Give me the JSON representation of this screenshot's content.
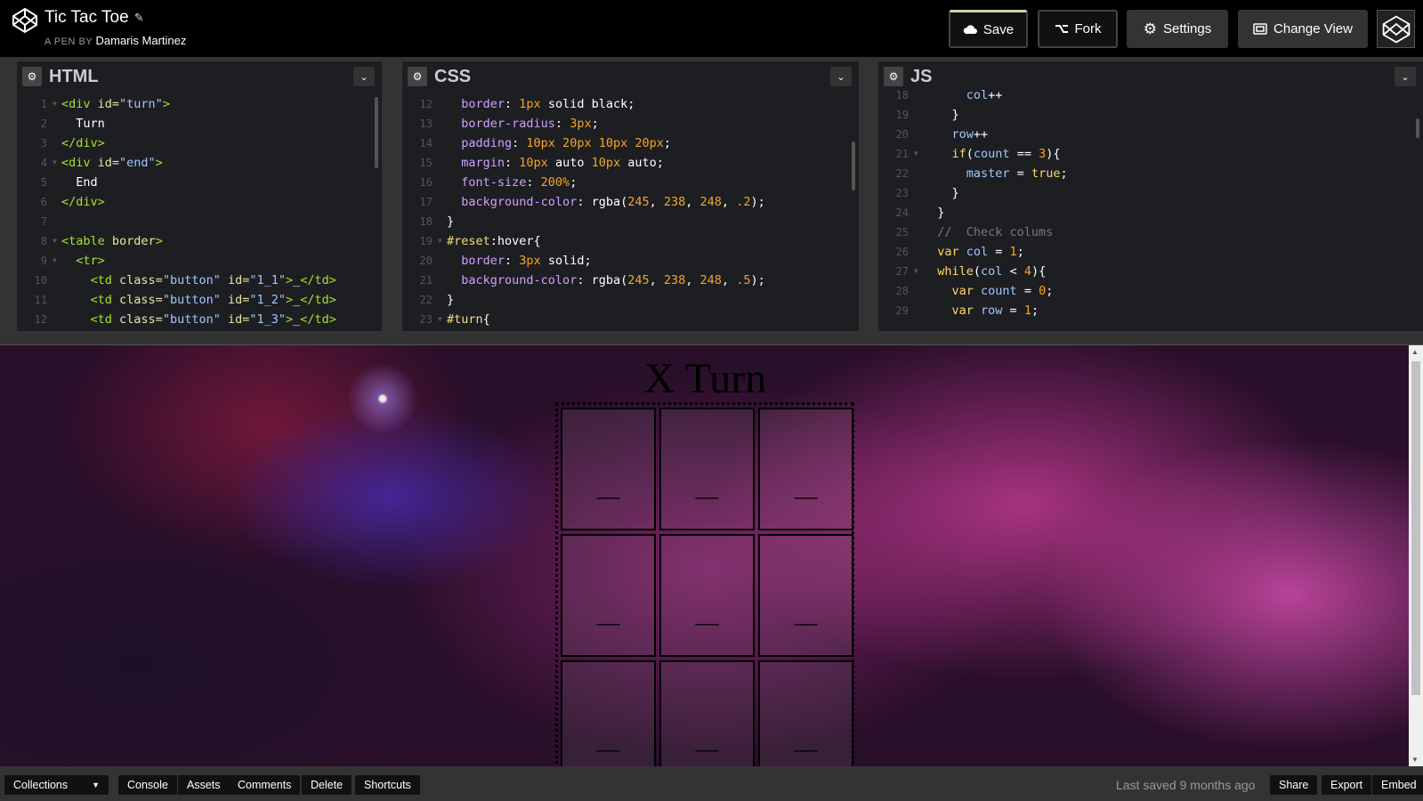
{
  "header": {
    "title": "Tic Tac Toe",
    "byline_prefix": "A PEN BY",
    "author": "Damaris Martinez",
    "buttons": {
      "save": "Save",
      "fork": "Fork",
      "settings": "Settings",
      "change_view": "Change View"
    }
  },
  "editors": {
    "html": {
      "title": "HTML",
      "lines": [
        {
          "n": "1",
          "fold": true,
          "tokens": [
            [
              "c-tag",
              "<div "
            ],
            [
              "c-attr",
              "id="
            ],
            [
              "c-str",
              "\"turn\""
            ],
            [
              "c-tag",
              ">"
            ]
          ]
        },
        {
          "n": "2",
          "fold": false,
          "tokens": [
            [
              "c-txt",
              "  Turn"
            ]
          ]
        },
        {
          "n": "3",
          "fold": false,
          "tokens": [
            [
              "c-tag",
              "</div>"
            ]
          ]
        },
        {
          "n": "4",
          "fold": true,
          "tokens": [
            [
              "c-tag",
              "<div "
            ],
            [
              "c-attr",
              "id="
            ],
            [
              "c-str",
              "\"end\""
            ],
            [
              "c-tag",
              ">"
            ]
          ]
        },
        {
          "n": "5",
          "fold": false,
          "tokens": [
            [
              "c-txt",
              "  End"
            ]
          ]
        },
        {
          "n": "6",
          "fold": false,
          "tokens": [
            [
              "c-tag",
              "</div>"
            ]
          ]
        },
        {
          "n": "7",
          "fold": false,
          "tokens": [
            [
              "c-txt",
              ""
            ]
          ]
        },
        {
          "n": "8",
          "fold": true,
          "tokens": [
            [
              "c-tag",
              "<table "
            ],
            [
              "c-attr",
              "border"
            ],
            [
              "c-tag",
              ">"
            ]
          ]
        },
        {
          "n": "9",
          "fold": true,
          "tokens": [
            [
              "c-tag",
              "  <tr>"
            ]
          ]
        },
        {
          "n": "10",
          "fold": false,
          "tokens": [
            [
              "c-tag",
              "    <td "
            ],
            [
              "c-attr",
              "class="
            ],
            [
              "c-str",
              "\"button\""
            ],
            [
              "c-attr",
              " id="
            ],
            [
              "c-str",
              "\"1_1\""
            ],
            [
              "c-tag",
              ">"
            ],
            [
              "c-txt",
              "_"
            ],
            [
              "c-tag",
              "</td>"
            ]
          ]
        },
        {
          "n": "11",
          "fold": false,
          "tokens": [
            [
              "c-tag",
              "    <td "
            ],
            [
              "c-attr",
              "class="
            ],
            [
              "c-str",
              "\"button\""
            ],
            [
              "c-attr",
              " id="
            ],
            [
              "c-str",
              "\"1_2\""
            ],
            [
              "c-tag",
              ">"
            ],
            [
              "c-txt",
              "_"
            ],
            [
              "c-tag",
              "</td>"
            ]
          ]
        },
        {
          "n": "12",
          "fold": false,
          "tokens": [
            [
              "c-tag",
              "    <td "
            ],
            [
              "c-attr",
              "class="
            ],
            [
              "c-str",
              "\"button\""
            ],
            [
              "c-attr",
              " id="
            ],
            [
              "c-str",
              "\"1_3\""
            ],
            [
              "c-tag",
              ">"
            ],
            [
              "c-txt",
              "_"
            ],
            [
              "c-tag",
              "</td>"
            ]
          ]
        }
      ]
    },
    "css": {
      "title": "CSS",
      "lines": [
        {
          "n": "12",
          "fold": false,
          "tokens": [
            [
              "c-prop",
              "  border"
            ],
            [
              "c-txt",
              ": "
            ],
            [
              "c-num",
              "1px"
            ],
            [
              "c-txt",
              " solid black;"
            ]
          ]
        },
        {
          "n": "13",
          "fold": false,
          "tokens": [
            [
              "c-prop",
              "  border-radius"
            ],
            [
              "c-txt",
              ": "
            ],
            [
              "c-num",
              "3px"
            ],
            [
              "c-txt",
              ";"
            ]
          ]
        },
        {
          "n": "14",
          "fold": false,
          "tokens": [
            [
              "c-prop",
              "  padding"
            ],
            [
              "c-txt",
              ": "
            ],
            [
              "c-num",
              "10px 20px 10px 20px"
            ],
            [
              "c-txt",
              ";"
            ]
          ]
        },
        {
          "n": "15",
          "fold": false,
          "tokens": [
            [
              "c-prop",
              "  margin"
            ],
            [
              "c-txt",
              ": "
            ],
            [
              "c-num",
              "10px"
            ],
            [
              "c-txt",
              " auto "
            ],
            [
              "c-num",
              "10px"
            ],
            [
              "c-txt",
              " auto;"
            ]
          ]
        },
        {
          "n": "16",
          "fold": false,
          "tokens": [
            [
              "c-prop",
              "  font-size"
            ],
            [
              "c-txt",
              ": "
            ],
            [
              "c-num",
              "200%"
            ],
            [
              "c-txt",
              ";"
            ]
          ]
        },
        {
          "n": "17",
          "fold": false,
          "tokens": [
            [
              "c-prop",
              "  background-color"
            ],
            [
              "c-txt",
              ": rgba("
            ],
            [
              "c-num",
              "245"
            ],
            [
              "c-txt",
              ", "
            ],
            [
              "c-num",
              "238"
            ],
            [
              "c-txt",
              ", "
            ],
            [
              "c-num",
              "248"
            ],
            [
              "c-txt",
              ", "
            ],
            [
              "c-num",
              ".2"
            ],
            [
              "c-txt",
              ");"
            ]
          ]
        },
        {
          "n": "18",
          "fold": false,
          "tokens": [
            [
              "c-txt",
              "}"
            ]
          ]
        },
        {
          "n": "19",
          "fold": true,
          "tokens": [
            [
              "c-sel",
              "#reset"
            ],
            [
              "c-txt",
              ":hover{"
            ]
          ]
        },
        {
          "n": "20",
          "fold": false,
          "tokens": [
            [
              "c-prop",
              "  border"
            ],
            [
              "c-txt",
              ": "
            ],
            [
              "c-num",
              "3px"
            ],
            [
              "c-txt",
              " solid;"
            ]
          ]
        },
        {
          "n": "21",
          "fold": false,
          "tokens": [
            [
              "c-prop",
              "  background-color"
            ],
            [
              "c-txt",
              ": rgba("
            ],
            [
              "c-num",
              "245"
            ],
            [
              "c-txt",
              ", "
            ],
            [
              "c-num",
              "238"
            ],
            [
              "c-txt",
              ", "
            ],
            [
              "c-num",
              "248"
            ],
            [
              "c-txt",
              ", "
            ],
            [
              "c-num",
              ".5"
            ],
            [
              "c-txt",
              ");"
            ]
          ]
        },
        {
          "n": "22",
          "fold": false,
          "tokens": [
            [
              "c-txt",
              "}"
            ]
          ]
        },
        {
          "n": "23",
          "fold": true,
          "tokens": [
            [
              "c-sel",
              "#turn"
            ],
            [
              "c-txt",
              "{"
            ]
          ]
        }
      ]
    },
    "js": {
      "title": "JS",
      "lines": [
        {
          "n": "18",
          "fold": false,
          "tokens": [
            [
              "c-str",
              "      col"
            ],
            [
              "c-txt",
              "++"
            ]
          ]
        },
        {
          "n": "19",
          "fold": false,
          "tokens": [
            [
              "c-txt",
              "    }"
            ]
          ]
        },
        {
          "n": "20",
          "fold": false,
          "tokens": [
            [
              "c-str",
              "    row"
            ],
            [
              "c-txt",
              "++"
            ]
          ]
        },
        {
          "n": "21",
          "fold": true,
          "tokens": [
            [
              "c-kw",
              "    if"
            ],
            [
              "c-txt",
              "("
            ],
            [
              "c-str",
              "count"
            ],
            [
              "c-txt",
              " == "
            ],
            [
              "c-num",
              "3"
            ],
            [
              "c-txt",
              "){"
            ]
          ]
        },
        {
          "n": "22",
          "fold": false,
          "tokens": [
            [
              "c-str",
              "      master"
            ],
            [
              "c-txt",
              " = "
            ],
            [
              "c-kw",
              "true"
            ],
            [
              "c-txt",
              ";"
            ]
          ]
        },
        {
          "n": "23",
          "fold": false,
          "tokens": [
            [
              "c-txt",
              "    }"
            ]
          ]
        },
        {
          "n": "24",
          "fold": false,
          "tokens": [
            [
              "c-txt",
              "  }"
            ]
          ]
        },
        {
          "n": "25",
          "fold": false,
          "tokens": [
            [
              "c-cm",
              "  //  Check colums"
            ]
          ]
        },
        {
          "n": "26",
          "fold": false,
          "tokens": [
            [
              "c-kw",
              "  var"
            ],
            [
              "c-str",
              " col"
            ],
            [
              "c-txt",
              " = "
            ],
            [
              "c-num",
              "1"
            ],
            [
              "c-txt",
              ";"
            ]
          ]
        },
        {
          "n": "27",
          "fold": true,
          "tokens": [
            [
              "c-kw",
              "  while"
            ],
            [
              "c-txt",
              "("
            ],
            [
              "c-str",
              "col"
            ],
            [
              "c-txt",
              " < "
            ],
            [
              "c-num",
              "4"
            ],
            [
              "c-txt",
              "){"
            ]
          ]
        },
        {
          "n": "28",
          "fold": false,
          "tokens": [
            [
              "c-kw",
              "    var"
            ],
            [
              "c-str",
              " count"
            ],
            [
              "c-txt",
              " = "
            ],
            [
              "c-num",
              "0"
            ],
            [
              "c-txt",
              ";"
            ]
          ]
        },
        {
          "n": "29",
          "fold": false,
          "tokens": [
            [
              "c-kw",
              "    var"
            ],
            [
              "c-str",
              " row"
            ],
            [
              "c-txt",
              " = "
            ],
            [
              "c-num",
              "1"
            ],
            [
              "c-txt",
              ";"
            ]
          ]
        }
      ]
    }
  },
  "preview": {
    "title": "X Turn",
    "cells": [
      "__",
      "__",
      "__",
      "__",
      "__",
      "__",
      "__",
      "__",
      "__"
    ]
  },
  "footer": {
    "collections": "Collections",
    "buttons": [
      "Console",
      "Assets",
      "Comments",
      "Delete",
      "Shortcuts"
    ],
    "saved_prefix": "Last saved",
    "saved_time": "9 months ago",
    "right_buttons": [
      "Share",
      "Export",
      "Embed"
    ]
  }
}
